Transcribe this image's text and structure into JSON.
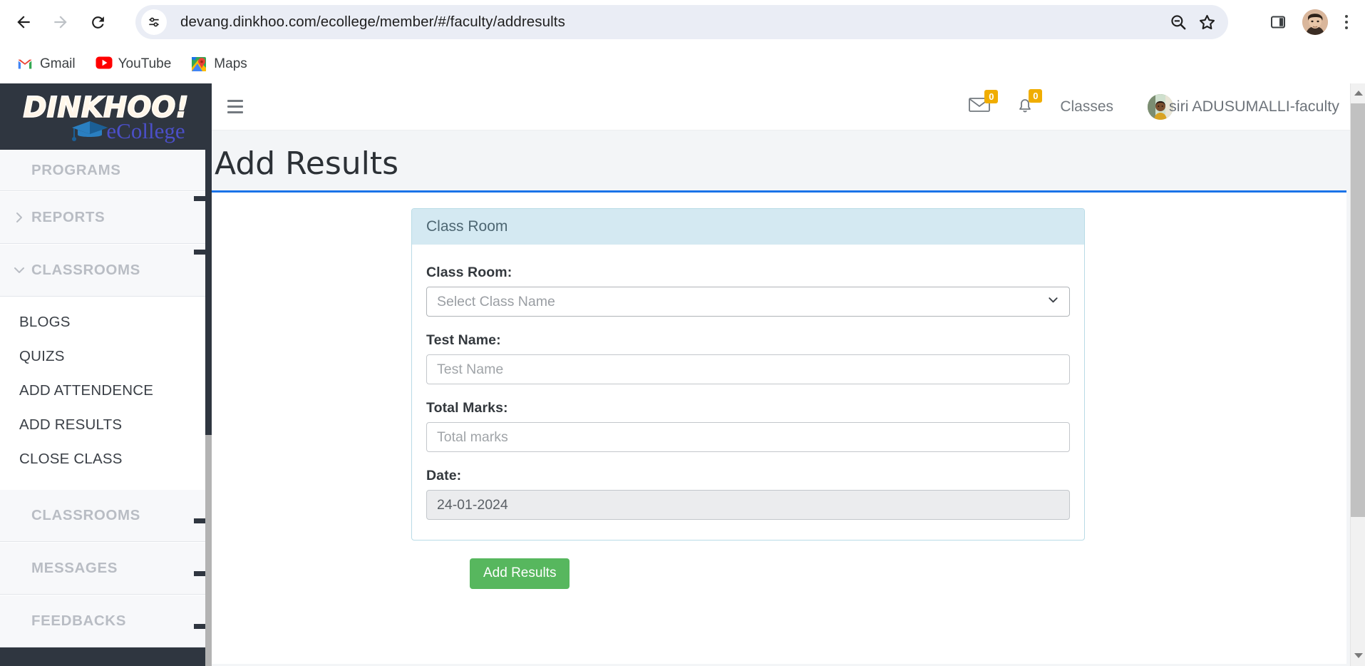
{
  "browser": {
    "url": "devang.dinkhoo.com/ecollege/member/#/faculty/addresults",
    "back_icon": "back-arrow-icon",
    "forward_icon": "forward-arrow-icon",
    "reload_icon": "reload-icon",
    "site_info_icon": "site-settings-icon",
    "zoom_out_icon": "zoom-out-icon",
    "bookmark_icon": "star-icon",
    "side_panel_icon": "side-panel-icon",
    "profile_icon": "profile-avatar",
    "menu_icon": "three-dots-menu-icon",
    "bookmarks": [
      {
        "label": "Gmail",
        "icon": "gmail-icon"
      },
      {
        "label": "YouTube",
        "icon": "youtube-icon"
      },
      {
        "label": "Maps",
        "icon": "google-maps-icon"
      }
    ]
  },
  "sidebar": {
    "logo": {
      "word": "DINKHOO!",
      "subtitle": "eCollege"
    },
    "sections": [
      {
        "label": "PROGRAMS",
        "chevron": "none"
      },
      {
        "label": "REPORTS",
        "chevron": "right"
      },
      {
        "label": "CLASSROOMS",
        "chevron": "down"
      },
      {
        "label": "CLASSROOMS",
        "chevron": "none"
      },
      {
        "label": "MESSAGES",
        "chevron": "none"
      },
      {
        "label": "FEEDBACKS",
        "chevron": "none"
      }
    ],
    "classrooms_items": [
      "BLOGS",
      "QUIZS",
      "ADD ATTENDENCE",
      "ADD RESULTS",
      "CLOSE CLASS"
    ]
  },
  "topbar": {
    "menu_toggle_icon": "hamburger-icon",
    "mail": {
      "icon": "envelope-icon",
      "count": "0"
    },
    "notifications": {
      "icon": "bell-icon",
      "count": "0"
    },
    "classes_label": "Classes",
    "user_name": "siri ADUSUMALLI-faculty",
    "badge_color": "#f0ad00"
  },
  "page": {
    "title": "Add Results",
    "accent_color": "#1a73e8"
  },
  "form": {
    "card_title": "Class Room",
    "card_header_bg": "#d4e9f2",
    "fields": [
      {
        "label": "Class Room:",
        "type": "select",
        "value": "Select Class Name",
        "placeholder": "Select Class Name"
      },
      {
        "label": "Test Name:",
        "type": "text",
        "value": "",
        "placeholder": "Test Name"
      },
      {
        "label": "Total Marks:",
        "type": "text",
        "value": "",
        "placeholder": "Total marks"
      },
      {
        "label": "Date:",
        "type": "readonly",
        "value": "24-01-2024",
        "placeholder": ""
      }
    ],
    "submit_label": "Add Results",
    "submit_color": "#57b75e"
  }
}
